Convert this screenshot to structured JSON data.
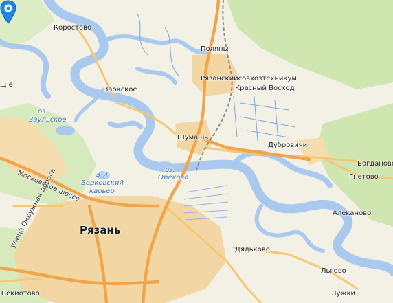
{
  "map": {
    "colors": {
      "land": "#f3f0e6",
      "forest": "#cfe6b0",
      "urban": "#f2d7a4",
      "water": "#a9c9ef",
      "water_line": "#7aa7e0",
      "road_major": "#f0a54a",
      "road_minor": "#f6c873",
      "railway": "#8e8e8e",
      "marker": "#1e88e5"
    },
    "marker": {
      "name": "map-location-pin"
    },
    "labels": {
      "korostovo": "Коростово",
      "polyany": "Поляны",
      "zaokskoe": "Заокское",
      "ryazansovkhoz": "Рязанскийсовхозтехникум",
      "krasny_voskhod": "Красный Восход",
      "shumash": "Шумашь",
      "dubrovichi": "Дубровичи",
      "bogdanovo": "Богданово",
      "gnetovo": "Гнетово",
      "alekanovo": "Алеканово",
      "ryazan": "Рязань",
      "dyadkovo": "Дядьково",
      "lgovo": "Льгово",
      "lukhi": "Лужки",
      "sekiotovo": "Секиотово",
      "edge_left": "щ е",
      "oz_zaulskoe_1": "оз.",
      "oz_zaulskoe_2": "Заульское",
      "oz_orekhovoe_1": "оз.",
      "oz_orekhovoe_2": "Орехово",
      "borkovsky_1": "3-й",
      "borkovsky_2": "Борковский",
      "borkovsky_3": "карьер",
      "moskovskoe_shosse": "Московское шоссе",
      "okruzhnaya": "улица Окружная дорога"
    }
  }
}
